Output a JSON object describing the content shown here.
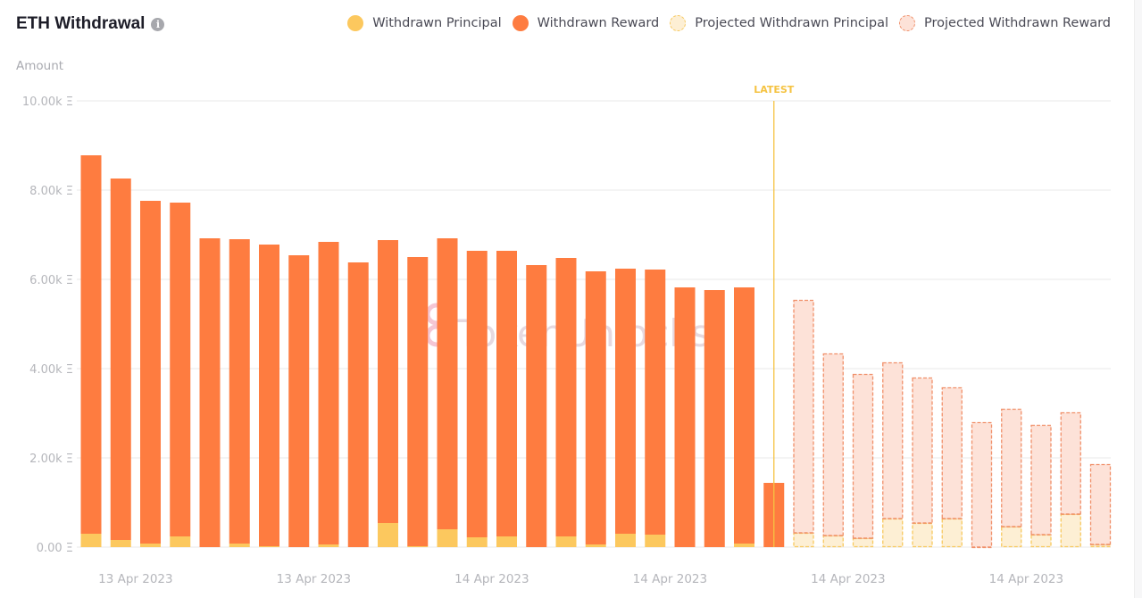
{
  "header": {
    "title": "ETH Withdrawal",
    "info_icon": "info-icon"
  },
  "legend": [
    {
      "label": "Withdrawn Principal",
      "key": "principal"
    },
    {
      "label": "Withdrawn Reward",
      "key": "reward"
    },
    {
      "label": "Projected Withdrawn Principal",
      "key": "proj_principal"
    },
    {
      "label": "Projected Withdrawn Reward",
      "key": "proj_reward"
    }
  ],
  "colors": {
    "principal": "#fcc85e",
    "reward": "#fe7c40",
    "proj_principal_fill": "#fdefd4",
    "proj_principal_stroke": "#f7c95f",
    "proj_reward_fill": "#fde2d8",
    "proj_reward_stroke": "#f0906a",
    "latest": "#f5c342",
    "grid": "#e8e8ea"
  },
  "watermark": "TokenUnlocks",
  "chart_data": {
    "type": "bar",
    "stacked": true,
    "title": "ETH Withdrawal",
    "ylabel": "Amount",
    "xlabel": "",
    "ylim": [
      0,
      10000
    ],
    "y_ticks": [
      {
        "value": 0,
        "label": "0.00 Ξ"
      },
      {
        "value": 2000,
        "label": "2.00k Ξ"
      },
      {
        "value": 4000,
        "label": "4.00k Ξ"
      },
      {
        "value": 6000,
        "label": "6.00k Ξ"
      },
      {
        "value": 8000,
        "label": "8.00k Ξ"
      },
      {
        "value": 10000,
        "label": "10.00k Ξ"
      }
    ],
    "x_tick_labels": [
      {
        "index": 1.5,
        "label": "13 Apr 2023"
      },
      {
        "index": 7.5,
        "label": "13 Apr 2023"
      },
      {
        "index": 13.5,
        "label": "14 Apr 2023"
      },
      {
        "index": 19.5,
        "label": "14 Apr 2023"
      },
      {
        "index": 25.5,
        "label": "14 Apr 2023"
      },
      {
        "index": 31.5,
        "label": "14 Apr 2023"
      }
    ],
    "grid": true,
    "legend_position": "top-right",
    "latest_marker": {
      "label": "LATEST",
      "after_index": 23
    },
    "series": [
      {
        "name": "Withdrawn Principal",
        "values": [
          300,
          160,
          80,
          240,
          0,
          80,
          20,
          0,
          60,
          0,
          540,
          20,
          400,
          220,
          240,
          0,
          240,
          60,
          300,
          280,
          0,
          0,
          80,
          0,
          null,
          null,
          null,
          null,
          null,
          null,
          null,
          null,
          null,
          null,
          null
        ]
      },
      {
        "name": "Withdrawn Reward",
        "values": [
          8480,
          8100,
          7680,
          7480,
          6920,
          6820,
          6760,
          6540,
          6780,
          6380,
          6340,
          6480,
          6520,
          6420,
          6400,
          6320,
          6240,
          6120,
          5940,
          5940,
          5820,
          5760,
          5740,
          1440,
          null,
          null,
          null,
          null,
          null,
          null,
          null,
          null,
          null,
          null,
          null
        ]
      },
      {
        "name": "Projected Withdrawn Principal",
        "values": [
          null,
          null,
          null,
          null,
          null,
          null,
          null,
          null,
          null,
          null,
          null,
          null,
          null,
          null,
          null,
          null,
          null,
          null,
          null,
          null,
          null,
          null,
          null,
          null,
          320,
          260,
          200,
          640,
          540,
          640,
          0,
          460,
          280,
          740,
          60
        ]
      },
      {
        "name": "Projected Withdrawn Reward",
        "values": [
          null,
          null,
          null,
          null,
          null,
          null,
          null,
          null,
          null,
          null,
          null,
          null,
          null,
          null,
          null,
          null,
          null,
          null,
          null,
          null,
          null,
          null,
          null,
          null,
          5220,
          4080,
          3680,
          3500,
          3260,
          2940,
          2800,
          2640,
          2460,
          2280,
          1800
        ]
      }
    ]
  }
}
